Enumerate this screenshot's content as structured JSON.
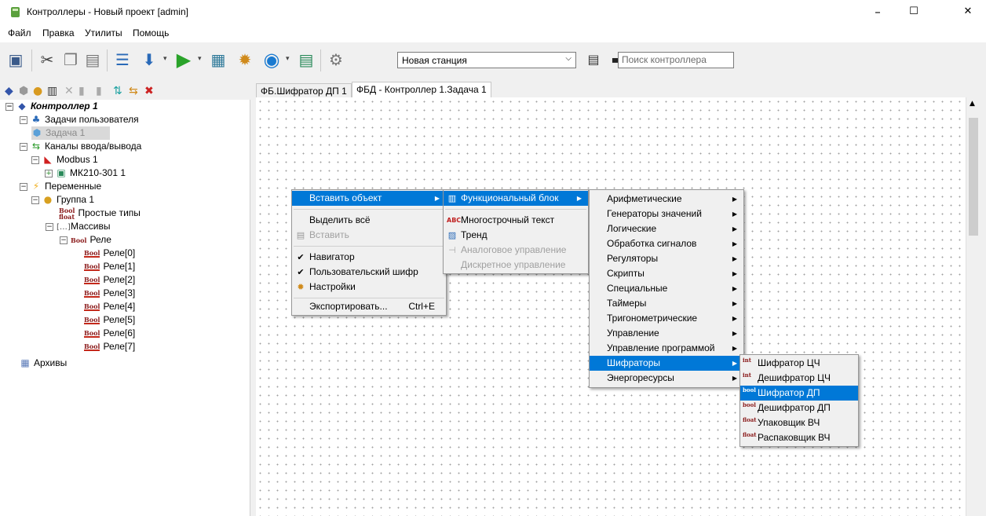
{
  "window": {
    "title": "Контроллеры - Новый проект [admin]",
    "minimize": "–",
    "maximize": "☐",
    "close": "✕"
  },
  "menubar": [
    "Файл",
    "Правка",
    "Утилиты",
    "Помощь"
  ],
  "toolbar": {
    "station_value": "Новая станция",
    "search_placeholder": "Поиск контроллера",
    "icons": [
      "save-icon",
      "cut-icon",
      "copy-icon",
      "paste-icon",
      "list-icon",
      "download-icon",
      "run-icon",
      "upload-icon",
      "gears-icon",
      "play-circle-icon",
      "document-icon",
      "settings-icon",
      "list-view-icon",
      "terminal-icon"
    ]
  },
  "tree": {
    "controller": "Контроллер 1",
    "user_tasks": "Задачи пользователя",
    "task1": "Задача 1",
    "io_channels": "Каналы ввода/вывода",
    "modbus": "Modbus 1",
    "module": "МК210-301 1",
    "variables": "Переменные",
    "group": "Группа 1",
    "simple_types": "Простые типы",
    "arrays": "Массивы",
    "relay": "Реле",
    "relays": [
      "Реле[0]",
      "Реле[1]",
      "Реле[2]",
      "Реле[3]",
      "Реле[4]",
      "Реле[5]",
      "Реле[6]",
      "Реле[7]"
    ],
    "archives": "Архивы",
    "bool_label": "Bool",
    "float_label": "float"
  },
  "tabs": [
    "ФБ.Шифратор ДП 1",
    "ФБД - Контроллер 1.Задача 1"
  ],
  "context_menu": {
    "insert_object": "Вставить объект",
    "select_all": "Выделить всё",
    "paste": "Вставить",
    "navigator": "Навигатор",
    "user_cipher": "Пользовательский шифр",
    "settings": "Настройки",
    "export": "Экспортировать...",
    "export_shortcut": "Ctrl+E",
    "check": "✔"
  },
  "insert_submenu": {
    "function_block": "Функциональный блок",
    "multiline_text": "Многострочный текст",
    "trend": "Тренд",
    "analog_control": "Аналоговое управление",
    "discrete_control": "Дискретное управление"
  },
  "fb_categories": [
    "Арифметические",
    "Генераторы значений",
    "Логические",
    "Обработка сигналов",
    "Регуляторы",
    "Скрипты",
    "Специальные",
    "Таймеры",
    "Тригонометрические",
    "Управление",
    "Управление программой",
    "Шифраторы",
    "Энергоресурсы"
  ],
  "ciphers": [
    "Шифратор ЦЧ",
    "Дешифратор ЦЧ",
    "Шифратор ДП",
    "Дешифратор ДП",
    "Упаковщик ВЧ",
    "Распаковщик ВЧ"
  ],
  "cipher_icon_labels": [
    "int",
    "int",
    "bool",
    "bool",
    "float",
    "float"
  ],
  "colors": {
    "highlight": "#0078d7",
    "canvas_dot": "#a0a0a0"
  }
}
